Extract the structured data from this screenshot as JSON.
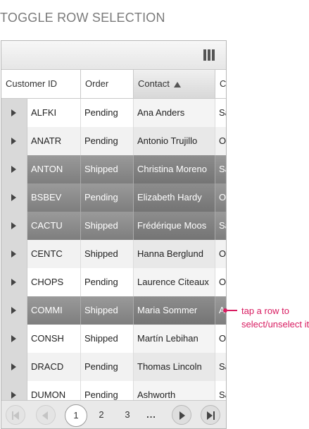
{
  "page": {
    "title": "TOGGLE ROW SELECTION"
  },
  "toolbar": {
    "column_chooser_icon": "column-chooser-icon"
  },
  "columns": [
    {
      "label": "Customer ID"
    },
    {
      "label": "Order"
    },
    {
      "label": "Contact",
      "sorted": "ascending"
    },
    {
      "label": "Co"
    }
  ],
  "rows": [
    {
      "id": "ALFKI",
      "order": "Pending",
      "contact": "Ana Anders",
      "country": "Sa",
      "selected": false
    },
    {
      "id": "ANATR",
      "order": "Pending",
      "contact": "Antonio Trujillo",
      "country": "O",
      "selected": false
    },
    {
      "id": "ANTON",
      "order": "Shipped",
      "contact": "Christina Moreno",
      "country": "Sa",
      "selected": true
    },
    {
      "id": "BSBEV",
      "order": "Pending",
      "contact": "Elizabeth Hardy",
      "country": "O",
      "selected": true
    },
    {
      "id": "CACTU",
      "order": "Shipped",
      "contact": "Frédérique Moos",
      "country": "Sa",
      "selected": true
    },
    {
      "id": "CENTC",
      "order": "Shipped",
      "contact": "Hanna Berglund",
      "country": "O",
      "selected": false
    },
    {
      "id": "CHOPS",
      "order": "Pending",
      "contact": "Laurence Citeaux",
      "country": "O",
      "selected": false
    },
    {
      "id": "COMMI",
      "order": "Shipped",
      "contact": "Maria Sommer",
      "country": "A",
      "selected": true
    },
    {
      "id": "CONSH",
      "order": "Shipped",
      "contact": "Martín Lebihan",
      "country": "O",
      "selected": false
    },
    {
      "id": "DRACD",
      "order": "Pending",
      "contact": "Thomas Lincoln",
      "country": "Sa",
      "selected": false
    },
    {
      "id": "DUMON",
      "order": "Pending",
      "contact": "Ashworth",
      "country": "Sa",
      "selected": false
    }
  ],
  "pager": {
    "pages": [
      "1",
      "2",
      "3",
      "..."
    ],
    "current": "1"
  },
  "annotation": {
    "line1": "tap a row to",
    "line2": "select/unselect it"
  },
  "colors": {
    "accent": "#d81b60",
    "selected_row": "#8a8a8a"
  }
}
